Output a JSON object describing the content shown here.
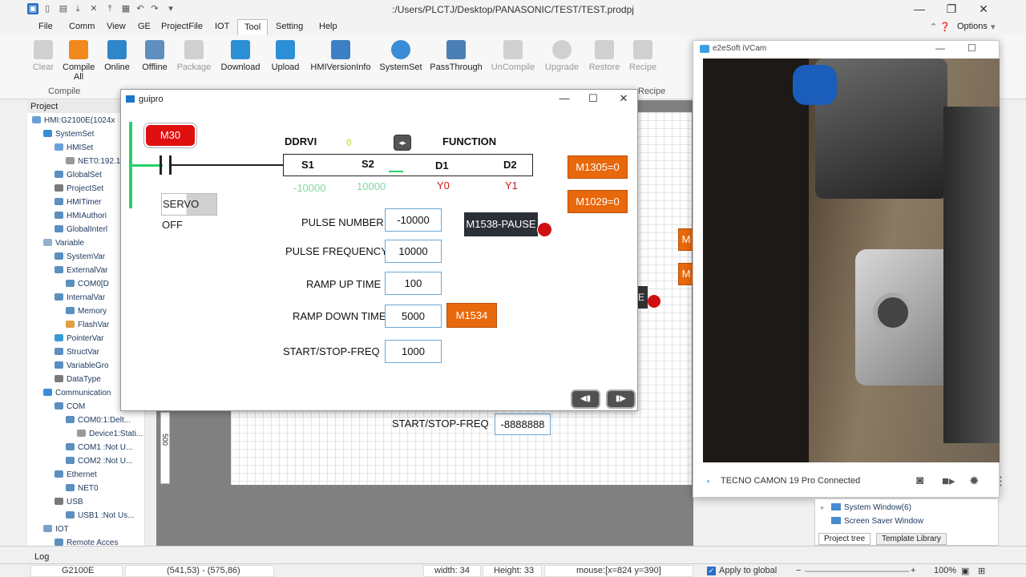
{
  "window": {
    "title": ":/Users/PLCTJ/Desktop/PANASONIC/TEST/TEST.prodpj",
    "options_label": "Options"
  },
  "menu": [
    "File",
    "Comm",
    "View",
    "GE",
    "ProjectFile",
    "IOT",
    "Tool",
    "Setting",
    "Help"
  ],
  "ribbon": {
    "buttons": [
      "Clear",
      "Compile All",
      "Online",
      "Offline",
      "Package",
      "Download",
      "Upload",
      "HMIVersionInfo",
      "SystemSet",
      "PassThrough",
      "UnCompile",
      "Upgrade",
      "Restore",
      "Recipe"
    ],
    "group_compile": "Compile",
    "group_recipe": "Recipe"
  },
  "project": {
    "header": "Project",
    "tree": [
      "HMI:G2100E(1024x",
      "SystemSet",
      "HMISet",
      "NET0:192.16",
      "GlobalSet",
      "ProjectSet",
      "HMITimer",
      "HMIAuthori",
      "GlobalInterl",
      "Variable",
      "SystemVar",
      "ExternalVar",
      "COM0[D",
      "InternalVar",
      "Memory",
      "FlashVar",
      "PointerVar",
      "StructVar",
      "VariableGro",
      "DataType",
      "Communication",
      "COM",
      "COM0:1:Delt...",
      "Device1:Stati...",
      "COM1 :Not U...",
      "COM2 :Not U...",
      "Ethernet",
      "NET0",
      "USB",
      "USB1 :Not Us...",
      "IOT",
      "Remote Acces"
    ]
  },
  "guipro": {
    "title": "guipro",
    "m30": "M30",
    "ddrvi": "DDRVI",
    "zero": "0",
    "function": "FUNCTION",
    "s1": "S1",
    "s2": "S2",
    "d1": "D1",
    "d2": "D2",
    "s1_val": "-10000",
    "s2_val": "10000",
    "y0": "Y0",
    "y1": "Y1",
    "servo": "SERVO OFF",
    "m1305": "M1305=0",
    "m1029": "M1029=0",
    "m1538": "M1538-PAUSE",
    "m1534": "M1534",
    "pulse_number_label": "PULSE NUMBER",
    "pulse_number": "-10000",
    "pulse_freq_label": "PULSE FREQUENCY",
    "pulse_freq": "10000",
    "ramp_up_label": "RAMP UP TIME",
    "ramp_up": "100",
    "ramp_down_label": "RAMP DOWN TIME",
    "ramp_down": "5000",
    "ssf_label": "START/STOP-FREQ",
    "ssf": "1000"
  },
  "background_editor": {
    "ssf_label": "START/STOP-FREQ",
    "ssf_val": "-8888888",
    "ruler": "500",
    "m_stub": "M",
    "e_stub": "E"
  },
  "camera": {
    "title": "e2eSoft iVCam",
    "status": "TECNO CAMON 19 Pro Connected"
  },
  "right_panel": {
    "items": [
      "System Window(6)",
      "Screen Saver Window"
    ],
    "tabs": [
      "Project tree",
      "Template Library"
    ]
  },
  "log_label": "Log",
  "status": {
    "device": "G2100E",
    "coords": "(541,53) - (575,86)",
    "width": "width: 34",
    "height": "Height: 33",
    "mouse": "mouse:[x=824  y=390]",
    "apply": "Apply to global",
    "zoom": "100%"
  }
}
